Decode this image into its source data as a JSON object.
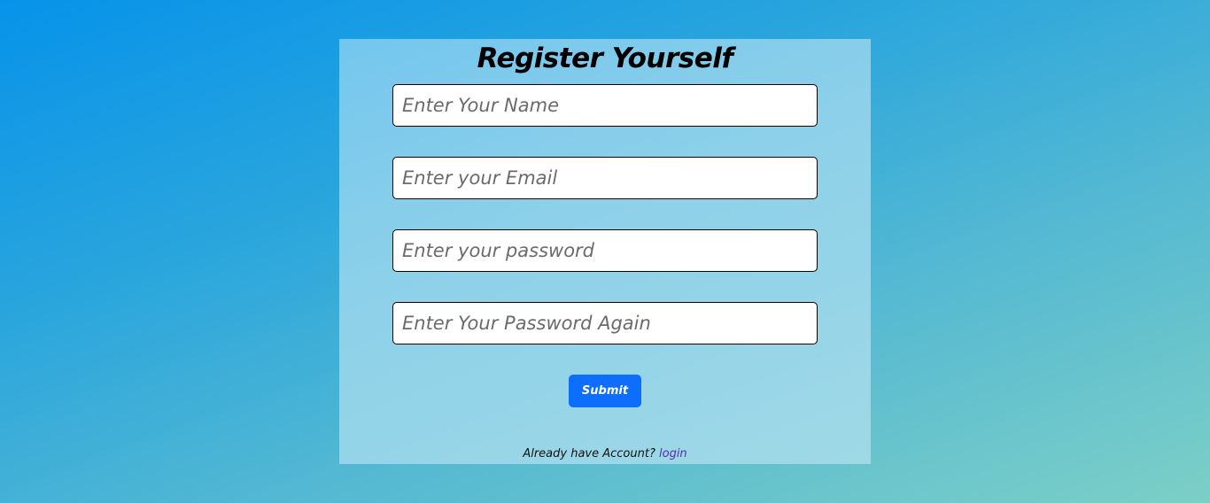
{
  "form": {
    "title": "Register Yourself",
    "fields": [
      {
        "placeholder": "Enter Your Name",
        "value": ""
      },
      {
        "placeholder": "Enter your Email",
        "value": ""
      },
      {
        "placeholder": "Enter your password",
        "value": ""
      },
      {
        "placeholder": "Enter Your Password Again",
        "value": ""
      }
    ],
    "submit_label": "Submit",
    "footer_text": "Already have Account?",
    "login_link": "login"
  },
  "colors": {
    "submit_button": "#0d6efd",
    "login_link": "#5a2ea6",
    "background_start": "#0793e9",
    "background_end": "#7ccfc6"
  }
}
